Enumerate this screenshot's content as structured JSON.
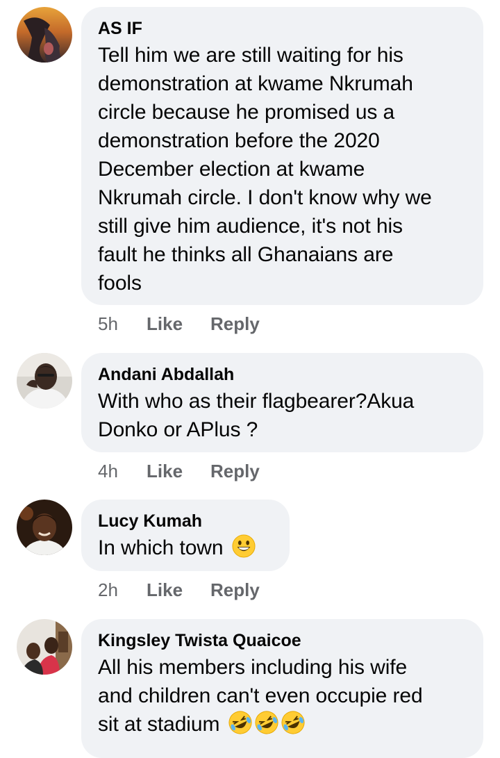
{
  "comments": [
    {
      "author": "AS IF",
      "lines": [
        "Tell him we are still waiting for his",
        "demonstration at kwame Nkrumah",
        "circle because he promised us a",
        "demonstration before the 2020",
        "December election at kwame",
        "Nkrumah circle. I don't know why we",
        "still give him audience, it's not his",
        "fault he thinks all Ghanaians are",
        "fools"
      ],
      "time": "5h",
      "like_label": "Like",
      "reply_label": "Reply"
    },
    {
      "author": "Andani Abdallah",
      "lines": [
        "With who as their flagbearer?Akua",
        "Donko or APlus ?"
      ],
      "time": "4h",
      "like_label": "Like",
      "reply_label": "Reply"
    },
    {
      "author": "Lucy Kumah",
      "lines": [
        "In which town"
      ],
      "emojis": [
        "grinning-face"
      ],
      "time": "2h",
      "like_label": "Like",
      "reply_label": "Reply"
    },
    {
      "author": "Kingsley Twista Quaicoe",
      "lines": [
        "All his members including his wife",
        "and children can't even occupie red",
        "sit at stadium"
      ],
      "emojis": [
        "rolling-on-floor-laughing",
        "rolling-on-floor-laughing",
        "rolling-on-floor-laughing"
      ]
    }
  ],
  "colors": {
    "bubble": "#f0f2f5",
    "text": "#050505",
    "meta": "#65676b"
  }
}
